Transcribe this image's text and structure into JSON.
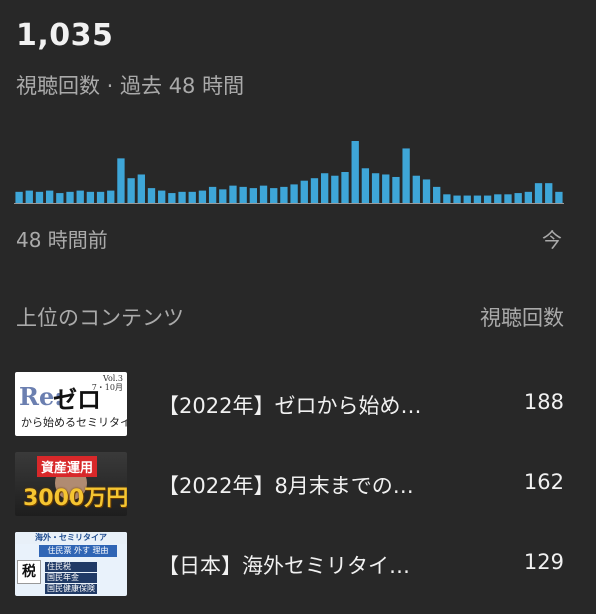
{
  "summary": {
    "views": "1,035",
    "caption": "視聴回数 · 過去 48 時間"
  },
  "chart_data": {
    "type": "bar",
    "title": "",
    "xlabel": "",
    "ylabel": "",
    "x_start_label": "48 時間前",
    "x_end_label": "今",
    "bar_color": "#3ea6d8",
    "grid": false,
    "values": [
      9,
      10,
      9,
      10,
      8,
      9,
      10,
      9,
      9,
      10,
      36,
      20,
      23,
      12,
      10,
      8,
      9,
      9,
      10,
      13,
      11,
      14,
      13,
      12,
      14,
      12,
      13,
      15,
      18,
      20,
      24,
      22,
      25,
      50,
      28,
      24,
      23,
      21,
      44,
      22,
      19,
      13,
      7,
      6,
      6,
      6,
      6,
      7,
      7,
      8,
      9,
      16,
      16,
      9
    ]
  },
  "top_content": {
    "title": "上位のコンテンツ",
    "column_label": "視聴回数",
    "items": [
      {
        "title": "【2022年】ゼロから始め…",
        "views": "188",
        "thumb": {
          "re": "Re:",
          "zero": "ゼロ",
          "vol": "Vol.3",
          "vol_sub": "7・10月",
          "sub": "から始めるセミリタイア生活"
        }
      },
      {
        "title": "【2022年】8月末までの…",
        "views": "162",
        "thumb": {
          "top": "資産運用",
          "big": "3000万円"
        }
      },
      {
        "title": "【日本】海外セミリタイ…",
        "views": "129",
        "thumb": {
          "band": "海外・セミリタイア",
          "red": "住民票 外す 理由",
          "zei": "税",
          "line1": "住民税",
          "line2": "国民年金",
          "line3": "国民健康保険"
        }
      }
    ]
  }
}
